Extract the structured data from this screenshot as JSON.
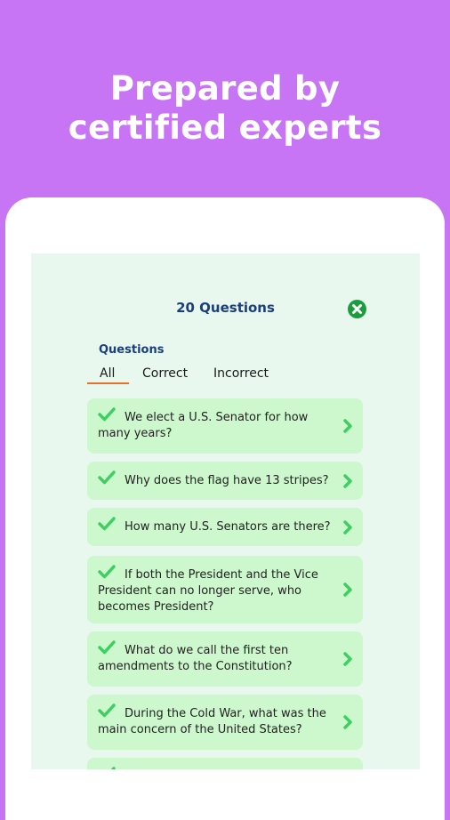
{
  "headline": {
    "line1": "Prepared by",
    "line2": "certified experts"
  },
  "panel": {
    "title": "20 Questions",
    "section_label": "Questions",
    "tabs": [
      "All",
      "Correct",
      "Incorrect"
    ],
    "active_tab": "All",
    "questions": [
      {
        "text": "We elect a U.S. Senator for how many years?",
        "status": "correct"
      },
      {
        "text": "Why does the flag have 13 stripes?",
        "status": "correct"
      },
      {
        "text": "How many U.S. Senators are there?",
        "status": "correct"
      },
      {
        "text": "If both the President and the Vice President can no longer serve, who becomes President?",
        "status": "correct"
      },
      {
        "text": "What do we call the first ten amendments to the Constitution?",
        "status": "correct"
      },
      {
        "text": "During the Cold War, what was the main concern of the United States?",
        "status": "correct"
      }
    ]
  },
  "colors": {
    "background": "#c774f5",
    "screen": "#e8f8ee",
    "card": "#cdf7cd",
    "accent_green": "#3ecf63",
    "close_green": "#1a9e3c",
    "title_blue": "#1b3f7d",
    "tab_underline": "#e8702a"
  },
  "icons": {
    "close": "close-circle-icon",
    "status": "checkmark-icon",
    "open": "chevron-right-icon"
  }
}
